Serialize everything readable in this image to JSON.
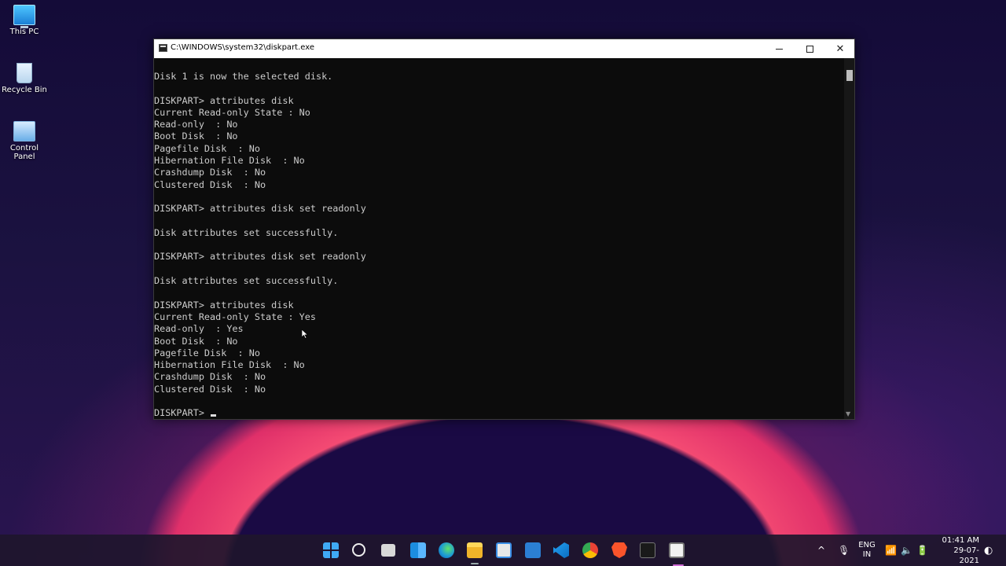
{
  "desktop": {
    "icons": [
      {
        "label": "This PC",
        "icon": "this-pc-icon"
      },
      {
        "label": "Recycle Bin",
        "icon": "recycle-bin-icon"
      },
      {
        "label": "Control Panel",
        "icon": "control-panel-icon"
      }
    ]
  },
  "window": {
    "title": "C:\\WINDOWS\\system32\\diskpart.exe",
    "minimize_glyph": "—",
    "maximize_glyph": "☐",
    "close_glyph": "✕"
  },
  "console": {
    "lines": [
      "Disk 1 is now the selected disk.",
      "",
      "DISKPART> attributes disk",
      "Current Read-only State : No",
      "Read-only  : No",
      "Boot Disk  : No",
      "Pagefile Disk  : No",
      "Hibernation File Disk  : No",
      "Crashdump Disk  : No",
      "Clustered Disk  : No",
      "",
      "DISKPART> attributes disk set readonly",
      "",
      "Disk attributes set successfully.",
      "",
      "DISKPART> attributes disk set readonly",
      "",
      "Disk attributes set successfully.",
      "",
      "DISKPART> attributes disk",
      "Current Read-only State : Yes",
      "Read-only  : Yes",
      "Boot Disk  : No",
      "Pagefile Disk  : No",
      "Hibernation File Disk  : No",
      "Crashdump Disk  : No",
      "Clustered Disk  : No",
      "",
      "DISKPART> "
    ]
  },
  "taskbar": {
    "apps": [
      "start-icon",
      "search-icon",
      "task-view-icon",
      "widgets-icon",
      "edge-icon",
      "file-explorer-icon",
      "store-icon",
      "mail-icon",
      "vscode-icon",
      "chrome-icon",
      "brave-icon",
      "terminal-icon",
      "diskpart-icon"
    ],
    "tray": {
      "chevron": "^",
      "lang_top": "ENG",
      "lang_bottom": "IN",
      "time": "01:41 AM",
      "date": "29-07-2021"
    }
  }
}
